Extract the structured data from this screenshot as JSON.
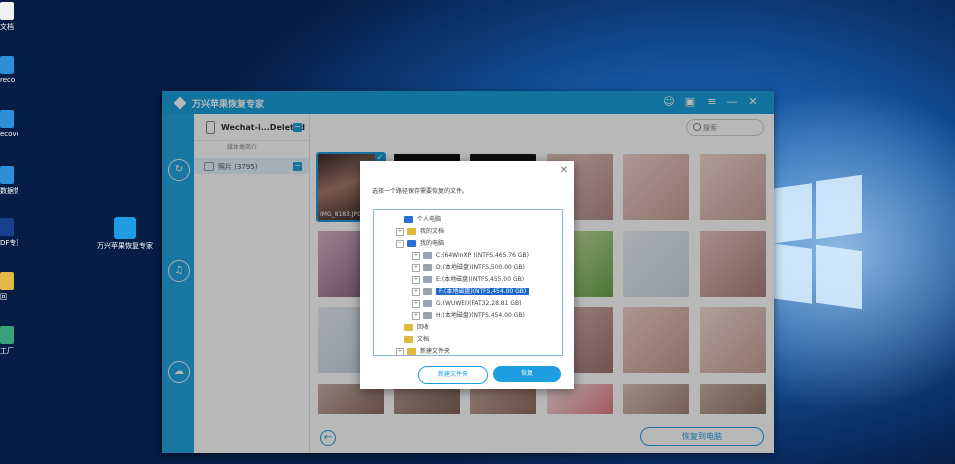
{
  "desktop": {
    "left_labels": [
      "文档",
      "reco",
      "ecove",
      "数据恢复专家",
      "DF专家",
      "回",
      "工厂"
    ],
    "center_icon_label": "万兴苹果恢复专家"
  },
  "app": {
    "title": "万兴苹果恢复专家",
    "header": {
      "device_title": "Wechat-i...Deleted",
      "sub_label": "媒体类简介",
      "row_label": "照片 (3795)"
    },
    "search_placeholder": "搜索",
    "selected_photo_caption": "IMG_8183.JPG",
    "recover_button": "恢复到电脑",
    "accent": "#1e9ee0"
  },
  "dialog": {
    "title": "选择一个路径保存需要恢复的文件。",
    "tree": [
      {
        "label": "个人电脑",
        "icon": "computer-icon"
      },
      {
        "label": "我的文档",
        "icon": "folder-icon"
      },
      {
        "label": "我的电脑",
        "icon": "computer-icon"
      },
      {
        "label": "C:(64WinXP )(NTFS,465.76 GB)",
        "icon": "drive-icon"
      },
      {
        "label": "D:(本地磁盘)(NTFS,500.00 GB)",
        "icon": "drive-icon"
      },
      {
        "label": "E:(本地磁盘)(NTFS,455.00 GB)",
        "icon": "drive-icon"
      },
      {
        "label": "F:(本地磁盘)(NTFS,454.00 GB)",
        "icon": "drive-icon",
        "selected": true
      },
      {
        "label": "G:(WUWEI)(FAT32,28.81 GB)",
        "icon": "drive-icon"
      },
      {
        "label": "H:(本地磁盘)(NTFS,454.00 GB)",
        "icon": "drive-icon"
      },
      {
        "label": "回收",
        "icon": "folder-icon"
      },
      {
        "label": "文档",
        "icon": "folder-icon"
      },
      {
        "label": "新建文件夹",
        "icon": "folder-icon"
      }
    ],
    "new_folder_button": "新建文件夹",
    "ok_button": "恢复"
  }
}
